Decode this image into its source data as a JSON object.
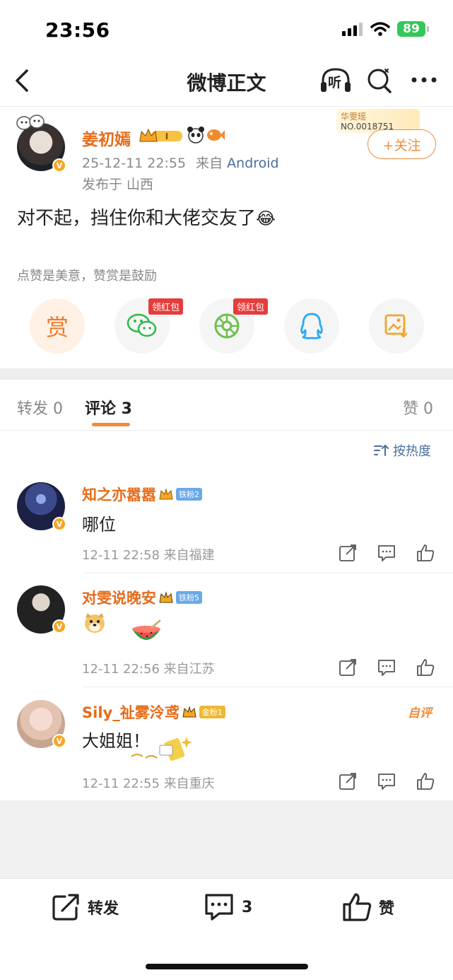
{
  "status_bar": {
    "time": "23:56",
    "battery": "89"
  },
  "nav": {
    "title": "微博正文",
    "listen_label": "听"
  },
  "post": {
    "author": "姜初嫣",
    "fan_card_title": "华雯瑶",
    "fan_card_no": "NO.0018751",
    "follow_label": "+关注",
    "date": "25-12-11 22:55",
    "from": "来自",
    "source": "Android",
    "location": "发布于 山西",
    "text": "对不起，挡住你和大佬交友了",
    "text_emoji": "😂",
    "reward_tip": "点赞是美意，赞赏是鼓励",
    "reward_label": "赏",
    "red_packet_tag_1": "领红包",
    "red_packet_tag_2": "领红包"
  },
  "tabs": {
    "repost": "转发 0",
    "comment": "评论 3",
    "like": "赞 0"
  },
  "sort_label": "按热度",
  "comments": [
    {
      "name": "知之亦嚣嚣",
      "badge": "铁粉2",
      "badge_color": "#6aa9e9",
      "text": "哪位",
      "meta": "12-11 22:58 来自福建"
    },
    {
      "name": "对雯说晚安",
      "badge": "铁粉5",
      "badge_color": "#6aa9e9",
      "text": "",
      "meta": "12-11 22:56 来自江苏"
    },
    {
      "name": "Sily_祉雾泠鸢",
      "badge": "金粉1",
      "badge_color": "#f0b832",
      "text": "大姐姐！",
      "meta": "12-11 22:55 来自重庆",
      "self_tag": "自评"
    }
  ],
  "bottom_bar": {
    "repost": "转发",
    "comment_count": "3",
    "like": "赞"
  },
  "colors": {
    "accent": "#f08c3a",
    "name": "#e86b18",
    "link": "#4a6d9c"
  }
}
